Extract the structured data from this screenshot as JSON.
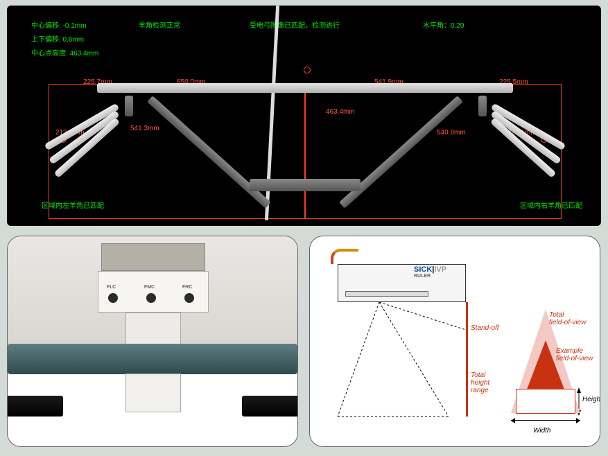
{
  "top": {
    "center_offset": "中心偏移: -0.1mm",
    "horn_status": "羊角检测正常",
    "panto_status": "受电弓图像已匹配，检测进行",
    "level": "水平角：0.20",
    "vert_offset": "上下偏移: 0.6mm",
    "center_height": "中心点高度: 463.4mm",
    "left_match": "区域内左羊角已匹配",
    "right_match": "区域内右羊角已匹配",
    "m_left_top": "225.7mm",
    "m_mid_top": "650.0mm",
    "m_center_h": "463.4mm",
    "m_right_top1": "541.9mm",
    "m_right_top2": "225.5mm",
    "m_left_tip": "213.7mm",
    "m_left_arm": "541.3mm",
    "m_right_arm": "540.8mm",
    "m_right_tip": "220.1mm"
  },
  "bl": {
    "port1": "FLC",
    "port2": "FMC",
    "port3": "FRC"
  },
  "br": {
    "brand_sick": "SICK",
    "brand_ivp": "IVP",
    "brand_sub": "RULER",
    "standoff": "Stand-off",
    "total_height": "Total\nheight\nrange",
    "total_fov": "Total\nfield-of-view",
    "example_fov": "Example\nfield-of-view",
    "height": "Height",
    "width": "Width"
  }
}
